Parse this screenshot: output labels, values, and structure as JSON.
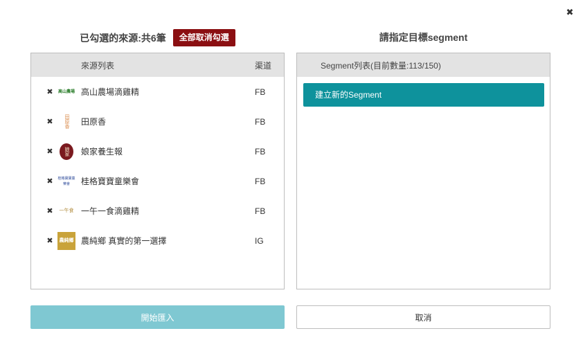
{
  "dialog": {
    "close_icon": "✖"
  },
  "left": {
    "title": "已勾選的來源:共6筆",
    "deselect_all_label": "全部取消勾選",
    "header": {
      "source_list": "來源列表",
      "channel": "渠道"
    },
    "remove_icon": "✖",
    "items": [
      {
        "logo_text": "高山農場",
        "name": "高山農場滴雞精",
        "channel": "FB"
      },
      {
        "logo_text": "田原香",
        "name": "田原香",
        "channel": "FB"
      },
      {
        "logo_text": "娘家",
        "name": "娘家養生報",
        "channel": "FB"
      },
      {
        "logo_text": "桂格寶寶童樂會",
        "name": "桂格寶寶童樂會",
        "channel": "FB"
      },
      {
        "logo_text": "一午食",
        "name": "一午一食滴雞精",
        "channel": "FB"
      },
      {
        "logo_text": "農純鄉",
        "name": "農純鄉 真實的第一選擇",
        "channel": "IG"
      }
    ]
  },
  "right": {
    "title": "請指定目標segment",
    "header": {
      "segment_list": "Segment列表(目前數量:113/150)"
    },
    "new_segment_label": "建立新的Segment"
  },
  "footer": {
    "start_import_label": "開始匯入",
    "cancel_label": "取消"
  },
  "colors": {
    "deselect_bg": "#8b0f12",
    "new_segment_bg": "#0e929c",
    "start_btn_bg": "#7fc8d2",
    "header_bg": "#e3e3e3"
  }
}
